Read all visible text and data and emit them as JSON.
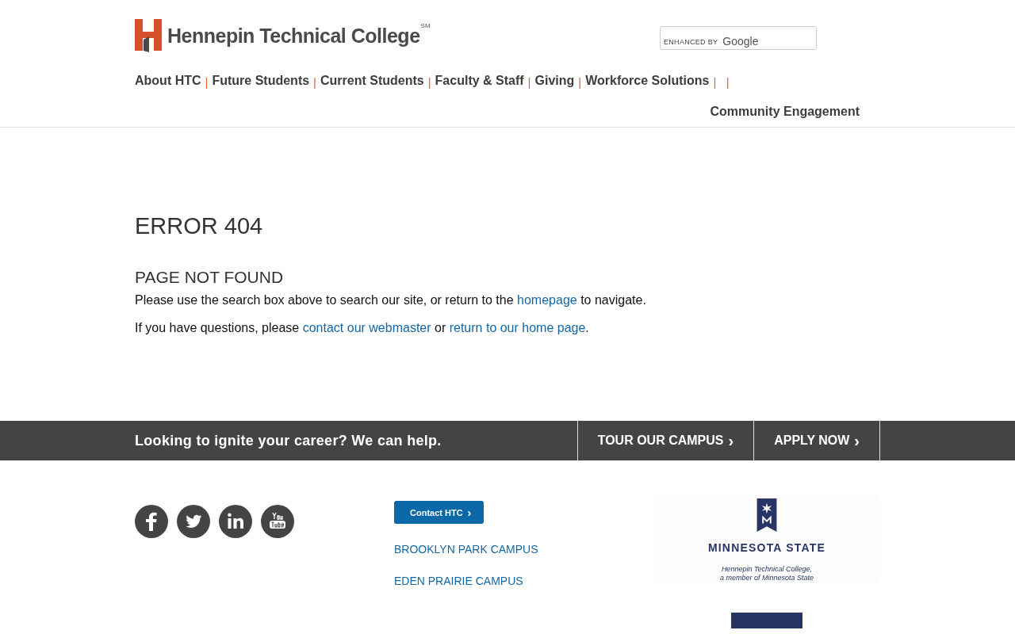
{
  "header": {
    "logo_text": "Hennepin Technical College",
    "logo_mark": "SM",
    "search": {
      "branding_prefix": "ENHANCED BY",
      "branding_brand": "Google"
    }
  },
  "nav": [
    {
      "label": "About HTC",
      "after": "|"
    },
    {
      "label": "Future Students",
      "after": "|"
    },
    {
      "label": "Current Students",
      "after": "|"
    },
    {
      "label": "Faculty & Staff",
      "after": "|"
    },
    {
      "label": "Giving",
      "after": "|"
    },
    {
      "label": "Workforce Solutions",
      "after": "|   |"
    },
    {
      "label": "Community Engagement"
    }
  ],
  "error": {
    "title": "ERROR 404",
    "subtitle": "PAGE NOT FOUND",
    "paragraphs": [
      [
        {
          "text": "Please use the search box above to search our site, or return to the "
        },
        {
          "text": "homepage",
          "link": true
        },
        {
          "text": " to navigate."
        }
      ],
      [
        {
          "text": "If you have questions, please "
        },
        {
          "text": "contact our webmaster",
          "link": true
        },
        {
          "text": " or "
        },
        {
          "text": "return to our home page",
          "link": true
        },
        {
          "text": "."
        }
      ]
    ]
  },
  "cta_bar": {
    "text": "Looking to ignite your career? We can help.",
    "buttons": [
      {
        "label": "TOUR OUR CAMPUS",
        "arrow": "›"
      },
      {
        "label": "APPLY NOW",
        "arrow": "›"
      }
    ]
  },
  "footer": {
    "social": [
      {
        "kind": "facebook"
      },
      {
        "kind": "twitter"
      },
      {
        "kind": "linkedin"
      },
      {
        "kind": "youtube"
      }
    ],
    "contact_button": {
      "label": "Contact HTC",
      "arrow": "›"
    },
    "campuses": [
      "BROOKLYN PARK CAMPUS",
      "EDEN PRAIRIE CAMPUS"
    ],
    "partner": {
      "name": "MINNESOTA STATE",
      "caption_line1": "Hennepin Technical College,",
      "caption_line2": "a member of Minnesota State"
    }
  }
}
